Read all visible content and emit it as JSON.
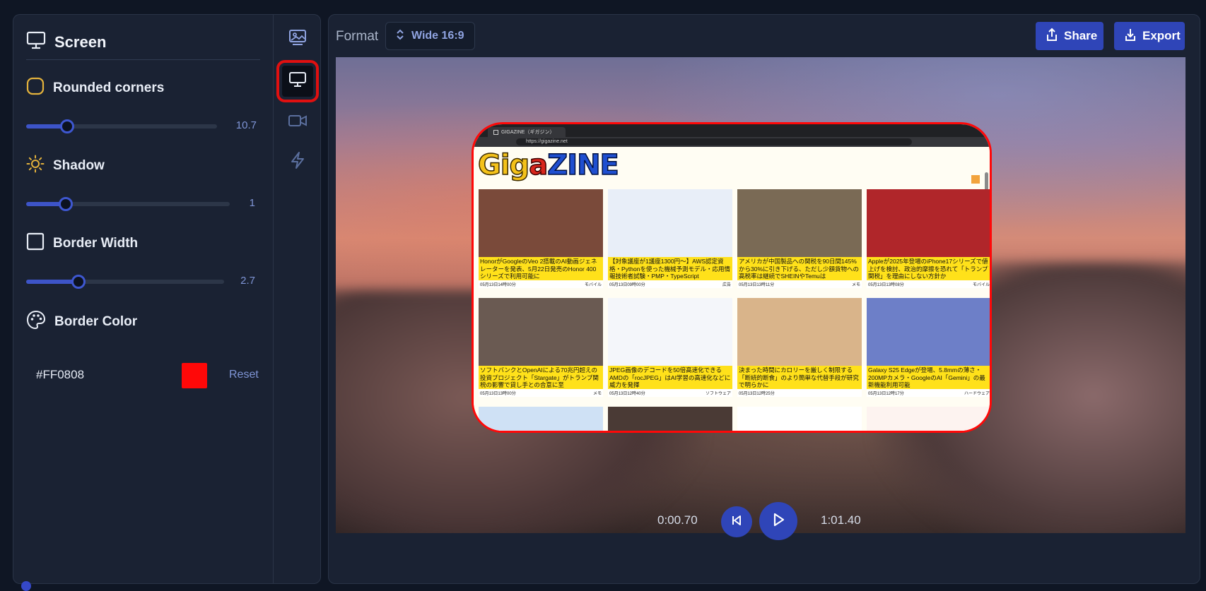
{
  "panel": {
    "title": "Screen",
    "rounded_corners": {
      "label": "Rounded corners",
      "value": "10.7",
      "fraction": 0.21
    },
    "shadow": {
      "label": "Shadow",
      "value": "1",
      "fraction": 0.2
    },
    "border_width": {
      "label": "Border Width",
      "value": "2.7",
      "fraction": 0.27
    },
    "border_color": {
      "label": "Border Color",
      "hex": "#FF0808",
      "reset_label": "Reset"
    }
  },
  "tabs": [
    {
      "icon": "image-icon",
      "active": false
    },
    {
      "icon": "monitor-icon",
      "active": true
    },
    {
      "icon": "video-icon",
      "active": false
    },
    {
      "icon": "lightning-icon",
      "active": false
    }
  ],
  "toolbar": {
    "format_label": "Format",
    "format_value": "Wide 16:9",
    "share_label": "Share",
    "export_label": "Export"
  },
  "preview": {
    "browser_tab_title": "GIGAZINE（ギガジン）",
    "url": "https://gigazine.net",
    "logo": {
      "part1": "Gig",
      "part2": "a",
      "part3": "ZINE"
    },
    "articles": [
      {
        "caption": "HonorがGoogleのVeo 2搭載のAI動画ジェネレーターを発表、5月22日発売のHonor 400シリーズで利用可能に",
        "date": "05月13日14時00分",
        "tag": "モバイル",
        "color": "#7a4a3a"
      },
      {
        "caption": "【対象議座が1議座1300円〜】AWS認定資格・Pythonを使った機械予測モデル・応用情報技術者試験・PMP・TypeScript",
        "date": "05月13日09時00分",
        "tag": "広告",
        "color": "#e8eef8"
      },
      {
        "caption": "アメリカが中国製品への関税を90日間145%から30%に引き下げる、ただし少額貨物への高税率は継続でSHEINやTemuは",
        "date": "05月13日13時11分",
        "tag": "メモ",
        "color": "#7a6a55"
      },
      {
        "caption": "Appleが2025年登場のiPhone17シリーズで値上げを検討、政治的摩擦を恐れて「トランプ関税」を理由にしない方針か",
        "date": "05月13日13時08分",
        "tag": "モバイル",
        "color": "#b0262a"
      },
      {
        "caption": "ソフトバンクとOpenAIによる70兆円超えの投資プロジェクト「Stargate」がトランプ関税の影響で貸し手との合意に至",
        "date": "05月13日13時00分",
        "tag": "メモ",
        "color": "#6a5a52"
      },
      {
        "caption": "JPEG画像のデコードを50倍高速化できるAMDの「rocJPEG」はAI学習の高速化などに威力を発揮",
        "date": "05月13日12時40分",
        "tag": "ソフトウェア",
        "color": "#f4f6fa"
      },
      {
        "caption": "決まった時間にカロリーを厳しく制限する「断続的断食」のより簡単な代替手段が研究で明らかに",
        "date": "05月13日12時25分",
        "tag": "",
        "color": "#d9b48a"
      },
      {
        "caption": "Galaxy S25 Edgeが登場、5.8mmの薄さ・200MPカメラ・GoogleのAI「Gemini」の最新機能利用可能",
        "date": "05月13日12時17分",
        "tag": "ハードウェア",
        "color": "#6d7fc8"
      }
    ]
  },
  "playback": {
    "current_time": "0:00.70",
    "total_time": "1:01.40"
  },
  "colors": {
    "accent": "#2f45b8",
    "border_color": "#FF0808",
    "panel_bg": "#1a2233",
    "page_bg": "#0f1624"
  }
}
